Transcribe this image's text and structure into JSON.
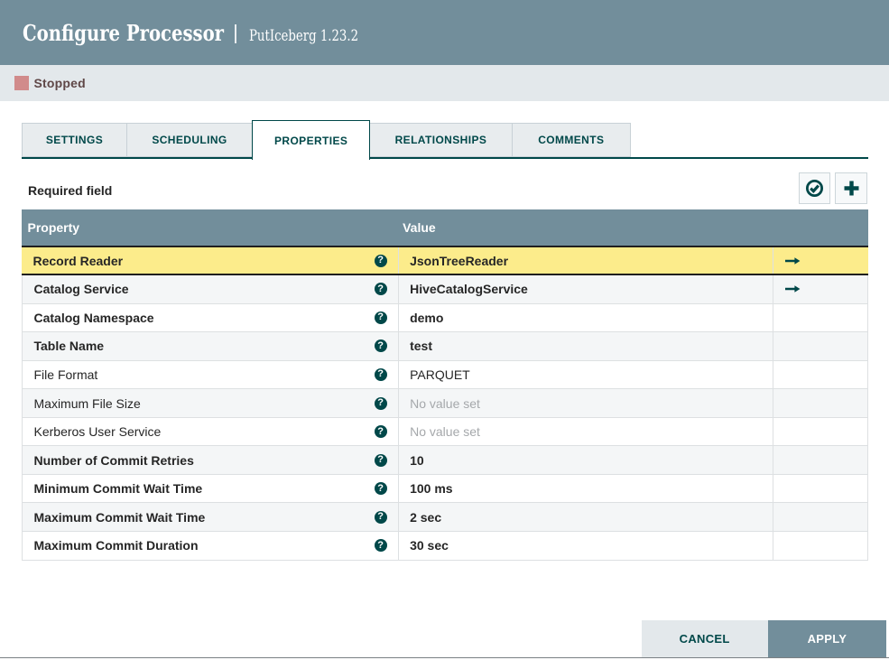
{
  "header": {
    "title": "Configure Processor",
    "subtitle": "PutIceberg 1.23.2"
  },
  "status": {
    "label": "Stopped"
  },
  "tabs": [
    {
      "label": "SETTINGS",
      "active": false
    },
    {
      "label": "SCHEDULING",
      "active": false
    },
    {
      "label": "PROPERTIES",
      "active": true
    },
    {
      "label": "RELATIONSHIPS",
      "active": false
    },
    {
      "label": "COMMENTS",
      "active": false
    }
  ],
  "properties_panel": {
    "required_hint": "Required field",
    "table": {
      "columns": {
        "property": "Property",
        "value": "Value"
      },
      "rows": [
        {
          "name": "Record Reader",
          "value": "JsonTreeReader",
          "required": true,
          "selected": true,
          "empty": false,
          "goto": true
        },
        {
          "name": "Catalog Service",
          "value": "HiveCatalogService",
          "required": true,
          "selected": false,
          "empty": false,
          "goto": true
        },
        {
          "name": "Catalog Namespace",
          "value": "demo",
          "required": true,
          "selected": false,
          "empty": false,
          "goto": false
        },
        {
          "name": "Table Name",
          "value": "test",
          "required": true,
          "selected": false,
          "empty": false,
          "goto": false
        },
        {
          "name": "File Format",
          "value": "PARQUET",
          "required": false,
          "selected": false,
          "empty": false,
          "goto": false
        },
        {
          "name": "Maximum File Size",
          "value": "No value set",
          "required": false,
          "selected": false,
          "empty": true,
          "goto": false
        },
        {
          "name": "Kerberos User Service",
          "value": "No value set",
          "required": false,
          "selected": false,
          "empty": true,
          "goto": false
        },
        {
          "name": "Number of Commit Retries",
          "value": "10",
          "required": true,
          "selected": false,
          "empty": false,
          "goto": false
        },
        {
          "name": "Minimum Commit Wait Time",
          "value": "100 ms",
          "required": true,
          "selected": false,
          "empty": false,
          "goto": false
        },
        {
          "name": "Maximum Commit Wait Time",
          "value": "2 sec",
          "required": true,
          "selected": false,
          "empty": false,
          "goto": false
        },
        {
          "name": "Maximum Commit Duration",
          "value": "30 sec",
          "required": true,
          "selected": false,
          "empty": false,
          "goto": false
        }
      ]
    }
  },
  "footer": {
    "cancel_label": "CANCEL",
    "apply_label": "APPLY"
  },
  "colors": {
    "header_bg": "#728E9B",
    "status_bar_bg": "#E3E8EB",
    "accent_teal": "#004849",
    "selected_row_bg": "#FCEC8B",
    "stripe_row_bg": "#F4F6F7",
    "stopped_square": "#D18B8B",
    "apply_button_bg": "#728E9B",
    "cancel_button_bg": "#E3E8EB"
  }
}
